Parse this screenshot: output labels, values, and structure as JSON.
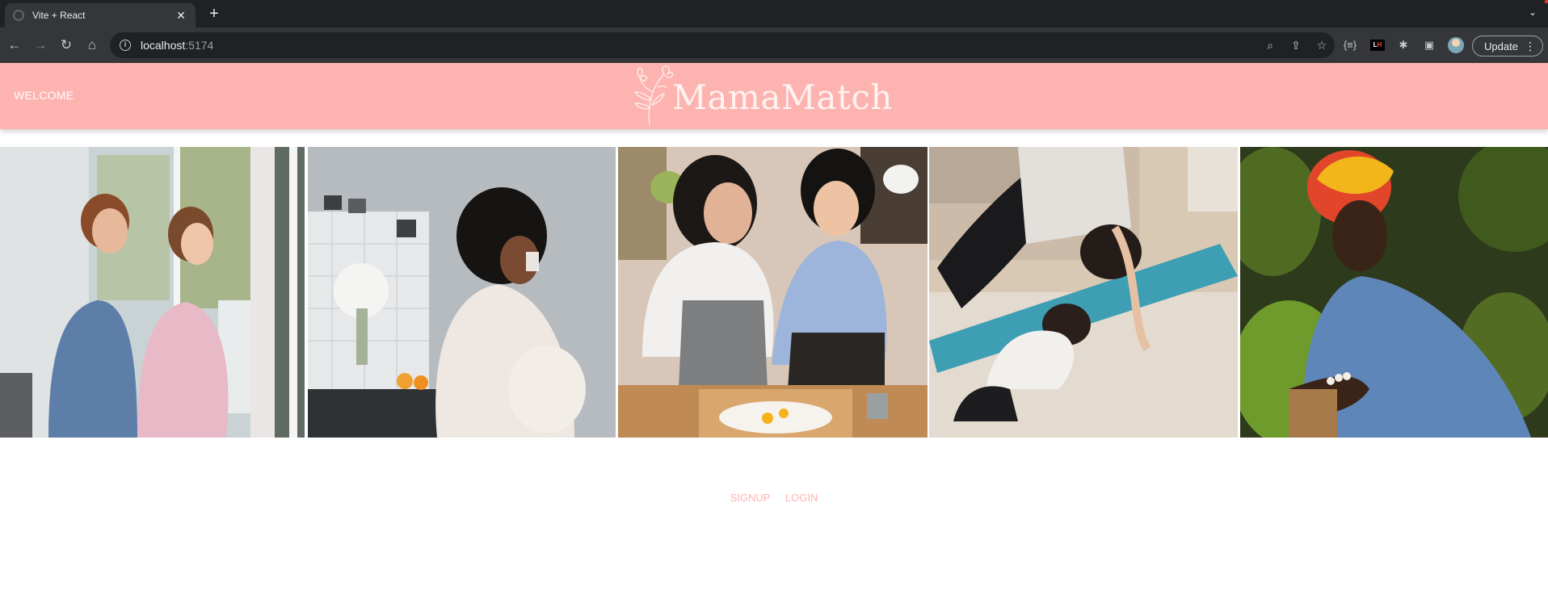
{
  "browser": {
    "tab_title": "Vite + React",
    "url_host": "localhost",
    "url_port": ":5174",
    "update_label": "Update",
    "icons": [
      "back-arrow-icon",
      "forward-arrow-icon",
      "reload-icon",
      "home-icon",
      "site-info-icon",
      "zoom-icon",
      "share-icon",
      "bookmark-star-icon",
      "extension-icon",
      "puzzle-icon",
      "sidepanel-icon",
      "profile-avatar-icon",
      "kebab-menu-icon"
    ]
  },
  "header": {
    "welcome_label": "WELCOME",
    "brand_name": "MamaMatch"
  },
  "gallery": {
    "photos": [
      {
        "name": "mother-and-daughter-at-window"
      },
      {
        "name": "pregnant-woman-drinking-milk"
      },
      {
        "name": "mother-and-daughter-baking"
      },
      {
        "name": "mother-and-child-yoga"
      },
      {
        "name": "pregnant-woman-in-headwrap"
      }
    ]
  },
  "footer": {
    "signup_label": "SIGNUP",
    "login_label": "LOGIN"
  },
  "colors": {
    "header_bg": "#fdb3b0",
    "link": "#fdb3b0",
    "chrome_dark": "#202124",
    "chrome_toolbar": "#35363a"
  }
}
